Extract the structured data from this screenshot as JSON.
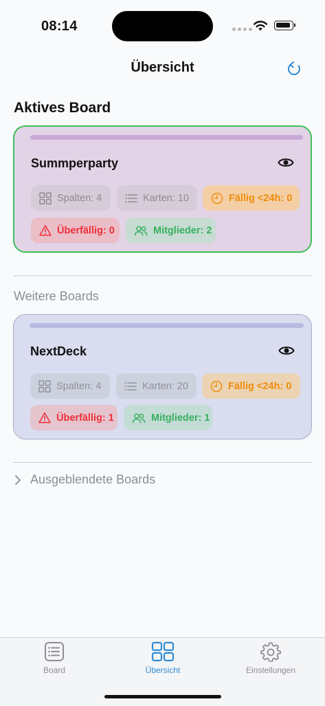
{
  "status_bar": {
    "time": "08:14"
  },
  "nav": {
    "title": "Übersicht",
    "refresh_icon": "refresh-icon"
  },
  "active_section": {
    "title": "Aktives Board"
  },
  "active_board": {
    "name": "Summperparty",
    "strip_color": "#c9a8d8",
    "stats": {
      "columns": "Spalten: 4",
      "cards": "Karten: 10",
      "due_24h": "Fällig <24h: 0",
      "overdue": "Überfällig: 0",
      "members": "Mitglieder: 2"
    }
  },
  "other_section": {
    "title": "Weitere Boards"
  },
  "other_boards": [
    {
      "name": "NextDeck",
      "strip_color": "#b6bbe0",
      "stats": {
        "columns": "Spalten: 4",
        "cards": "Karten: 20",
        "due_24h": "Fällig <24h: 0",
        "overdue": "Überfällig: 1",
        "members": "Mitglieder: 1"
      }
    }
  ],
  "hidden_boards": {
    "label": "Ausgeblendete Boards"
  },
  "tabbar": {
    "tabs": [
      {
        "label": "Board",
        "icon": "list-board-icon",
        "active": false
      },
      {
        "label": "Übersicht",
        "icon": "grid-icon",
        "active": true
      },
      {
        "label": "Einstellungen",
        "icon": "gear-icon",
        "active": false
      }
    ]
  },
  "colors": {
    "accent": "#2f8cd6",
    "active_border": "#3fbf5a",
    "due_orange": "#ef8c0b",
    "overdue_red": "#ee2f3a",
    "members_green": "#37b060"
  }
}
